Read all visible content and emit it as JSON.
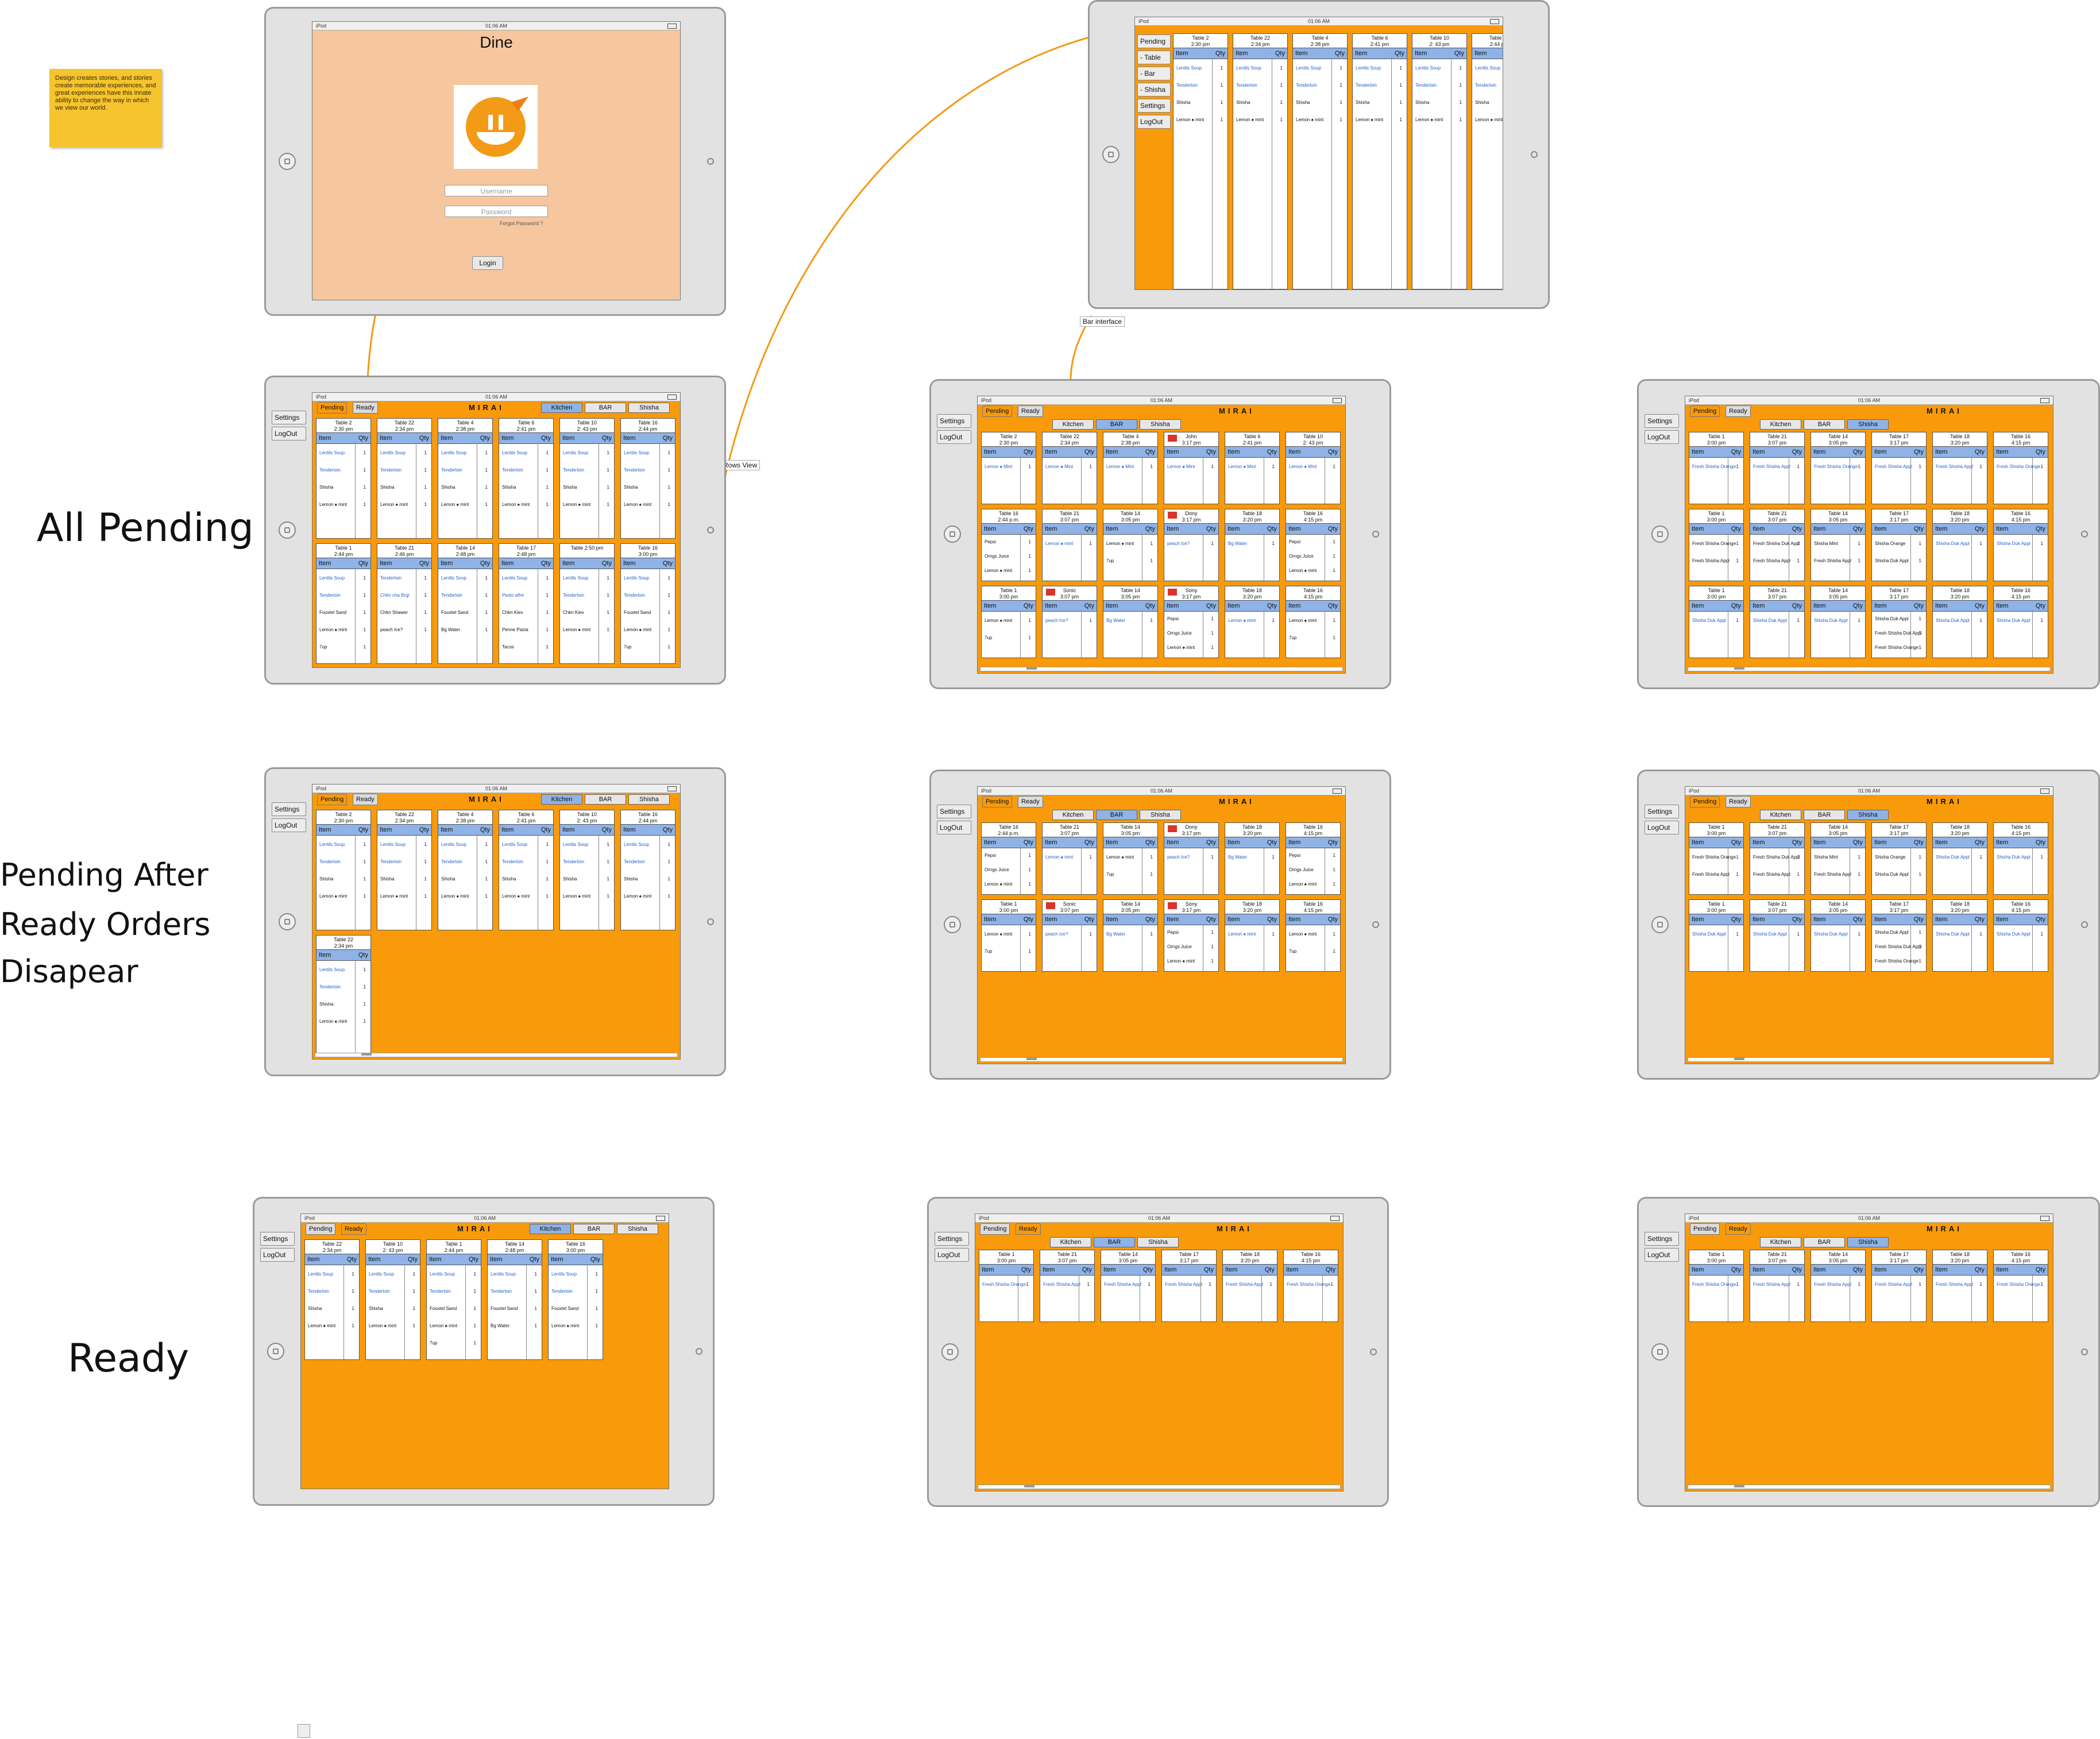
{
  "note": "Design creates stories, and stories create memorable experiences, and great experiences have this innate ability to change the way in which we view our world.",
  "row_labels": {
    "all_pending": "All Pending",
    "pending_after_1": "Pending After",
    "pending_after_2": "Ready Orders",
    "pending_after_3": "Disapear",
    "ready": "Ready"
  },
  "callouts": {
    "rows_view": "1 Rows View",
    "bar_interface": "Bar interface"
  },
  "device": {
    "carrier": "iPod",
    "time": "01:06 AM"
  },
  "login": {
    "title": "Dine",
    "username_placeholder": "Username",
    "password_placeholder": "Password",
    "forgot": "Forgot Password ?",
    "login_button": "Login"
  },
  "app": {
    "brand": "MIRAI",
    "tab_pending": "Pending",
    "tab_ready": "Ready",
    "kitchen": "Kitchen",
    "bar": "BAR",
    "shisha": "Shisha",
    "settings": "Settings",
    "logout": "LogOut",
    "col_item": "Item",
    "col_qty": "Qty"
  },
  "list_view": {
    "menu": [
      "Pending",
      "- Table",
      "- Bar",
      "- Shisha",
      "Settings",
      "LogOut"
    ]
  },
  "kitchen_tables_row1": [
    {
      "table": "Table 2",
      "time": "2:30 pm",
      "items": [
        [
          "Lentils Soup",
          "1"
        ],
        [
          "Tenderloin",
          "1"
        ],
        [
          "Shisha",
          "1"
        ],
        [
          "Lemon ♠ mint",
          "1"
        ]
      ]
    },
    {
      "table": "Table 22",
      "time": "2:34 pm",
      "items": [
        [
          "Lentils Soup",
          "1"
        ],
        [
          "Tenderloin",
          "1"
        ],
        [
          "Shisha",
          "1"
        ],
        [
          "Lemon ♠ mint",
          "1"
        ]
      ]
    },
    {
      "table": "Table 4",
      "time": "2:38 pm",
      "items": [
        [
          "Lentils Soup",
          "1"
        ],
        [
          "Tenderloin",
          "1"
        ],
        [
          "Shisha",
          "1"
        ],
        [
          "Lemon ♠ mint",
          "1"
        ]
      ]
    },
    {
      "table": "Table 6",
      "time": "2:41 pm",
      "items": [
        [
          "Lentils Soup",
          "1"
        ],
        [
          "Tenderloin",
          "1"
        ],
        [
          "Shisha",
          "1"
        ],
        [
          "Lemon ♠ mint",
          "1"
        ]
      ]
    },
    {
      "table": "Table 10",
      "time": "2: 43 pm",
      "items": [
        [
          "Lentils Soup",
          "1"
        ],
        [
          "Tenderloin",
          "1"
        ],
        [
          "Shisha",
          "1"
        ],
        [
          "Lemon ♠ mint",
          "1"
        ]
      ]
    },
    {
      "table": "Table 16",
      "time": "2:44 pm",
      "items": [
        [
          "Lentils Soup",
          "1"
        ],
        [
          "Tenderloin",
          "1"
        ],
        [
          "Shisha",
          "1"
        ],
        [
          "Lemon ♠ mint",
          "1"
        ]
      ]
    }
  ],
  "kitchen_tables_row2": [
    {
      "table": "Table 1",
      "time": "2:44 pm",
      "items": [
        [
          "Lentils Soup",
          "1"
        ],
        [
          "Tenderloin",
          "1"
        ],
        [
          "Fouxtel Sand",
          "1"
        ],
        [
          "Lemon ♠ mint",
          "1"
        ],
        [
          "7up",
          "1"
        ]
      ]
    },
    {
      "table": "Table 21",
      "time": "2:46 pm",
      "items": [
        [
          "Tenderloin",
          "1"
        ],
        [
          "Chkn cha Brgr",
          "1"
        ],
        [
          "Chkn Shawer",
          "1"
        ],
        [
          "peach Ice?",
          "1"
        ]
      ]
    },
    {
      "table": "Table 14",
      "time": "2:48 pm",
      "items": [
        [
          "Lentils Soup",
          "1"
        ],
        [
          "Tenderloin",
          "1"
        ],
        [
          "Fouxtel Sand",
          "1"
        ],
        [
          "Bg Water",
          "1"
        ]
      ]
    },
    {
      "table": "Table 17",
      "time": "2:48 pm",
      "items": [
        [
          "Lentils Soup",
          "1"
        ],
        [
          "Pesto alfre",
          "1"
        ],
        [
          "Chkn Kiev",
          "1"
        ],
        [
          "Penne Pasta",
          "1"
        ],
        [
          "Tacos",
          "1"
        ]
      ]
    },
    {
      "table": "Table 2:50 pm",
      "time": "",
      "items": [
        [
          "Lentils Soup",
          "1"
        ],
        [
          "Tenderloin",
          "1"
        ],
        [
          "Chkn Kiev",
          "1"
        ],
        [
          "Lemon ♠ mint",
          "1"
        ]
      ]
    },
    {
      "table": "Table 16",
      "time": "3:00 pm",
      "items": [
        [
          "Lentils Soup",
          "1"
        ],
        [
          "Tenderloin",
          "1"
        ],
        [
          "Fouxtel Sand",
          "1"
        ],
        [
          "Lemon ♠ mint",
          "1"
        ],
        [
          "7up",
          "1"
        ]
      ]
    }
  ],
  "bar_tables_row1": [
    {
      "table": "Table 2",
      "time": "2:30 pm",
      "items": [
        [
          "Lemon ♠ Mint",
          "1"
        ]
      ]
    },
    {
      "table": "Table 22",
      "time": "2:34 pm",
      "items": [
        [
          "Lemon ♠ Mint",
          "1"
        ]
      ]
    },
    {
      "table": "Table 4",
      "time": "2:38 pm",
      "items": [
        [
          "Lemon ♠ Mint",
          "1"
        ]
      ]
    },
    {
      "table": "John",
      "time": "3:17 pm",
      "items": [
        [
          "Lemon ♠ Mint",
          "1"
        ]
      ]
    },
    {
      "table": "Table 6",
      "time": "2:41 pm",
      "items": [
        [
          "Lemon ♠ Mint",
          "1"
        ]
      ]
    },
    {
      "table": "Table 10",
      "time": "2: 43 pm",
      "items": [
        [
          "Lemon ♠ Mint",
          "1"
        ]
      ]
    }
  ],
  "bar_tables_row2": [
    {
      "table": "Table 16",
      "time": "2:44 p.m.",
      "items": [
        [
          "Pepsi",
          "1"
        ],
        [
          "Orngs Juice",
          "1"
        ],
        [
          "Lemon ♠ mint",
          "1"
        ]
      ]
    },
    {
      "table": "Table 21",
      "time": "3:07 pm",
      "items": [
        [
          "Lemon ♠ mint",
          "1"
        ]
      ]
    },
    {
      "table": "Table 14",
      "time": "3:05 pm",
      "items": [
        [
          "Lemon ♠ mint",
          "1"
        ],
        [
          "7up",
          "1"
        ]
      ]
    },
    {
      "table": "Dony",
      "time": "3:17 pm",
      "items": [
        [
          "peach Ice?",
          "1"
        ]
      ]
    },
    {
      "table": "Table 18",
      "time": "3:20 pm",
      "items": [
        [
          "Bg Water",
          "1"
        ]
      ]
    },
    {
      "table": "Table 16",
      "time": "4:15 pm",
      "items": [
        [
          "Pepsi",
          "1"
        ],
        [
          "Orngs Juice",
          "1"
        ],
        [
          "Lemon ♠ mint",
          "1"
        ]
      ]
    }
  ],
  "bar_tables_row3": [
    {
      "table": "Table 1",
      "time": "3:00 pm",
      "items": [
        [
          "Lemon ♠ mint",
          "1"
        ],
        [
          "7up",
          "1"
        ]
      ]
    },
    {
      "table": "Sonic",
      "time": "3:07 pm",
      "items": [
        [
          "peach Ice?",
          "1"
        ]
      ]
    },
    {
      "table": "Table 14",
      "time": "3:05 pm",
      "items": [
        [
          "Bg Water",
          "1"
        ]
      ]
    },
    {
      "table": "Sony",
      "time": "3:17 pm",
      "items": [
        [
          "Pepsi",
          "1"
        ],
        [
          "Orngs Juice",
          "1"
        ],
        [
          "Lemon ♠ mint",
          "1"
        ]
      ]
    },
    {
      "table": "Table 18",
      "time": "3:20 pm",
      "items": [
        [
          "Lemon ♠ mint",
          "1"
        ]
      ]
    },
    {
      "table": "Table 16",
      "time": "4:15 pm",
      "items": [
        [
          "Lemon ♠ mint",
          "1"
        ],
        [
          "7up",
          "1"
        ]
      ]
    }
  ],
  "shisha_tables_row1": [
    {
      "table": "Table 1",
      "time": "3:00 pm",
      "items": [
        [
          "Fresh Shisha Orange",
          "1"
        ]
      ]
    },
    {
      "table": "Table 21",
      "time": "3:07 pm",
      "items": [
        [
          "Fresh Shisha Appl",
          "1"
        ]
      ]
    },
    {
      "table": "Table 14",
      "time": "3:05 pm",
      "items": [
        [
          "Fresh Shisha Orange",
          "1"
        ]
      ]
    },
    {
      "table": "Table 17",
      "time": "3:17 pm",
      "items": [
        [
          "Fresh Shisha Appl",
          "1"
        ]
      ]
    },
    {
      "table": "Table 18",
      "time": "3:20 pm",
      "items": [
        [
          "Fresh Shisha Appl",
          "1"
        ]
      ]
    },
    {
      "table": "Table 16",
      "time": "4:15 pm",
      "items": [
        [
          "Fresh Shisha Orange",
          "1"
        ]
      ]
    }
  ],
  "shisha_tables_row2": [
    {
      "table": "Table 1",
      "time": "3:00 pm",
      "items": [
        [
          "Fresh Shisha Orange",
          "1"
        ],
        [
          "Fresh Shisha Appl",
          "1"
        ]
      ]
    },
    {
      "table": "Table 21",
      "time": "3:07 pm",
      "items": [
        [
          "Fresh Shisha Duk Appl",
          "1"
        ],
        [
          "Fresh Shisha Appl",
          "1"
        ]
      ]
    },
    {
      "table": "Table 14",
      "time": "3:05 pm",
      "items": [
        [
          "Shisha Mint",
          "1"
        ],
        [
          "Fresh Shisha Appl",
          "1"
        ]
      ]
    },
    {
      "table": "Table 17",
      "time": "3:17 pm",
      "items": [
        [
          "Shisha Orange",
          "1"
        ],
        [
          "Shisha Duk Appl",
          "1"
        ]
      ]
    },
    {
      "table": "Table 18",
      "time": "3:20 pm",
      "items": [
        [
          "Shisha Duk Appl",
          "1"
        ]
      ]
    },
    {
      "table": "Table 16",
      "time": "4:15 pm",
      "items": [
        [
          "Shisha Duk Appl",
          "1"
        ]
      ]
    }
  ],
  "shisha_tables_row3": [
    {
      "table": "Table 1",
      "time": "3:00 pm",
      "items": [
        [
          "Shisha Duk Appl",
          "1"
        ]
      ]
    },
    {
      "table": "Table 21",
      "time": "3:07 pm",
      "items": [
        [
          "Shisha Duk Appl",
          "1"
        ]
      ]
    },
    {
      "table": "Table 14",
      "time": "3:05 pm",
      "items": [
        [
          "Shisha Duk Appl",
          "1"
        ]
      ]
    },
    {
      "table": "Table 17",
      "time": "3:17 pm",
      "items": [
        [
          "Shisha Duk Appl",
          "1"
        ],
        [
          "Fresh Shisha Duk Appl",
          "1"
        ],
        [
          "Fresh Shisha Orange",
          "1"
        ]
      ]
    },
    {
      "table": "Table 18",
      "time": "3:20 pm",
      "items": [
        [
          "Shisha Duk Appl",
          "1"
        ]
      ]
    },
    {
      "table": "Table 16",
      "time": "4:15 pm",
      "items": [
        [
          "Shisha Duk Appl",
          "1"
        ]
      ]
    }
  ],
  "ready_kitchen": [
    {
      "table": "Table 22",
      "time": "2:34 pm",
      "items": [
        [
          "Lentils Soup",
          "1"
        ],
        [
          "Tenderloin",
          "1"
        ],
        [
          "Shisha",
          "1"
        ],
        [
          "Lemon ♠ mint",
          "1"
        ]
      ]
    },
    {
      "table": "Table 10",
      "time": "2: 43 pm",
      "items": [
        [
          "Lentils Soup",
          "1"
        ],
        [
          "Tenderloin",
          "1"
        ],
        [
          "Shisha",
          "1"
        ],
        [
          "Lemon ♠ mint",
          "1"
        ]
      ]
    },
    {
      "table": "Table 1",
      "time": "2:44 pm",
      "items": [
        [
          "Lentils Soup",
          "1"
        ],
        [
          "Tenderloin",
          "1"
        ],
        [
          "Fouxtel Sand",
          "1"
        ],
        [
          "Lemon ♠ mint",
          "1"
        ],
        [
          "7up",
          "1"
        ]
      ]
    },
    {
      "table": "Table 14",
      "time": "2:48 pm",
      "items": [
        [
          "Lentils Soup",
          "1"
        ],
        [
          "Tenderloin",
          "1"
        ],
        [
          "Fouxtel Sand",
          "1"
        ],
        [
          "Bg Water",
          "1"
        ]
      ]
    },
    {
      "table": "Table 16",
      "time": "3:00 pm",
      "items": [
        [
          "Lentils Soup",
          "1"
        ],
        [
          "Tenderloin",
          "1"
        ],
        [
          "Fouxtel Sand",
          "1"
        ],
        [
          "Lemon ♠ mint",
          "1"
        ]
      ]
    }
  ],
  "ready_bar": [
    {
      "table": "Table 1",
      "time": "3:00 pm",
      "items": [
        [
          "Fresh Shisha Orange",
          "1"
        ]
      ]
    },
    {
      "table": "Table 21",
      "time": "3:07 pm",
      "items": [
        [
          "Fresh Shisha Appl",
          "1"
        ]
      ]
    },
    {
      "table": "Table 14",
      "time": "3:05 pm",
      "items": [
        [
          "Fresh Shisha Appl",
          "1"
        ]
      ]
    },
    {
      "table": "Table 17",
      "time": "3:17 pm",
      "items": [
        [
          "Fresh Shisha Appl",
          "1"
        ]
      ]
    },
    {
      "table": "Table 18",
      "time": "3:20 pm",
      "items": [
        [
          "Fresh Shisha Appl",
          "1"
        ]
      ]
    },
    {
      "table": "Table 16",
      "time": "4:15 pm",
      "items": [
        [
          "Fresh Shisha Orange",
          "1"
        ]
      ]
    }
  ],
  "colors": {
    "accent": "#f99a0a",
    "header_blue": "#8fb3e6",
    "login_bg": "#f6c79e",
    "link_blue": "#2460c9",
    "flag_red": "#d9342b"
  }
}
